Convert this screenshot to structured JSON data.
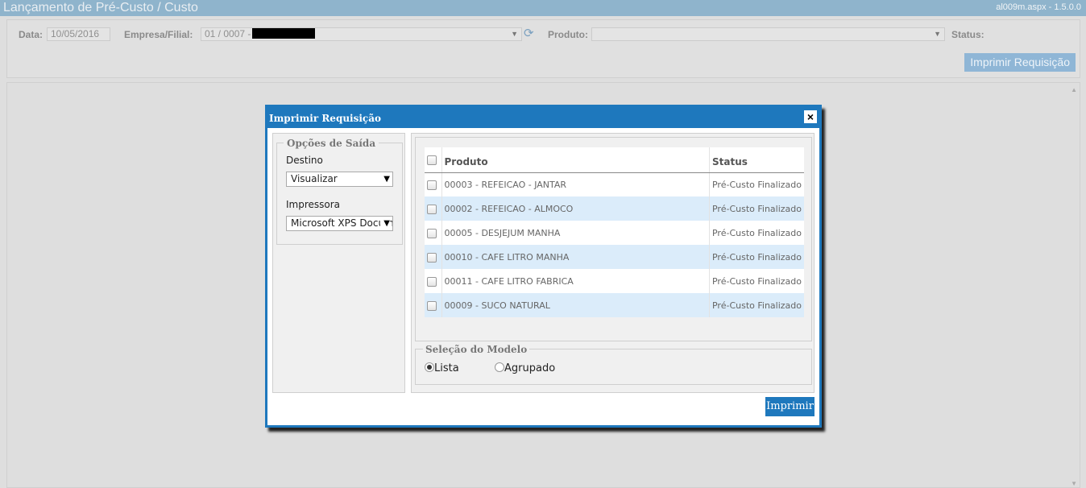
{
  "header": {
    "title": "Lançamento de Pré-Custo / Custo",
    "version": "al009m.aspx - 1.5.0.0"
  },
  "filters": {
    "data_label": "Data:",
    "data_value": "10/05/2016",
    "empresa_label": "Empresa/Filial:",
    "empresa_value": "01 / 0007 -",
    "produto_label": "Produto:",
    "produto_value": "",
    "status_label": "Status:",
    "imprimir_requisicao_label": "Imprimir Requisição"
  },
  "modal": {
    "title": "Imprimir Requisição",
    "close_label": "×",
    "opcoes": {
      "legend": "Opções de Saída",
      "destino_label": "Destino",
      "destino_value": "Visualizar",
      "impressora_label": "Impressora",
      "impressora_value": "Microsoft XPS Document Writer"
    },
    "grid": {
      "col_produto": "Produto",
      "col_status": "Status",
      "rows": [
        {
          "produto": "00003 - REFEICAO - JANTAR",
          "status": "Pré-Custo Finalizado"
        },
        {
          "produto": "00002 - REFEICAO - ALMOCO",
          "status": "Pré-Custo Finalizado"
        },
        {
          "produto": "00005 - DESJEJUM MANHA",
          "status": "Pré-Custo Finalizado"
        },
        {
          "produto": "00010 - CAFE LITRO MANHA",
          "status": "Pré-Custo Finalizado"
        },
        {
          "produto": "00011 - CAFE LITRO FABRICA",
          "status": "Pré-Custo Finalizado"
        },
        {
          "produto": "00009 - SUCO NATURAL",
          "status": "Pré-Custo Finalizado"
        }
      ]
    },
    "modelo": {
      "legend": "Seleção do Modelo",
      "option_lista": "Lista",
      "option_agrupado": "Agrupado",
      "selected": "Lista"
    },
    "imprimir_label": "Imprimir"
  },
  "colors": {
    "accent": "#1e78bd",
    "row_alt": "#dbecfa",
    "header_bar": "#8fb4cc"
  }
}
